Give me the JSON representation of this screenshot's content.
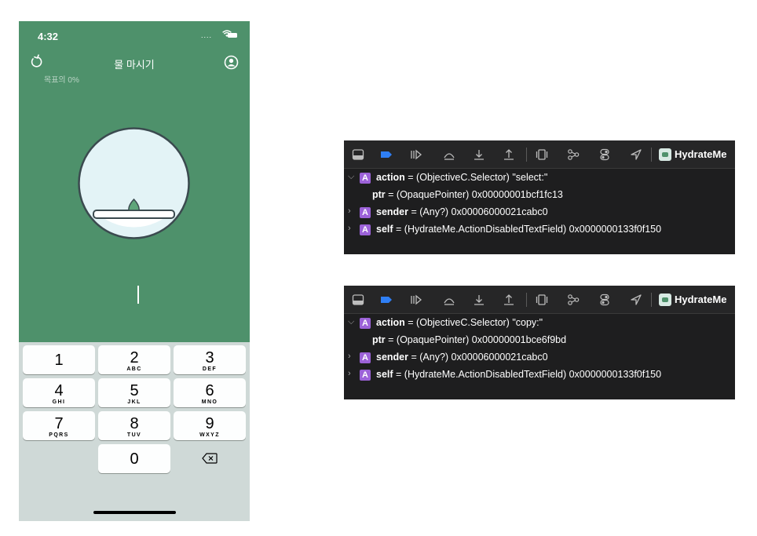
{
  "phone": {
    "status_time": "4:32",
    "signal_dots": "....",
    "nav_title": "물 마시기",
    "progress_label": "목표의 0%",
    "keys": [
      {
        "num": "1",
        "letters": ""
      },
      {
        "num": "2",
        "letters": "ABC"
      },
      {
        "num": "3",
        "letters": "DEF"
      },
      {
        "num": "4",
        "letters": "GHI"
      },
      {
        "num": "5",
        "letters": "JKL"
      },
      {
        "num": "6",
        "letters": "MNO"
      },
      {
        "num": "7",
        "letters": "PQRS"
      },
      {
        "num": "8",
        "letters": "TUV"
      },
      {
        "num": "9",
        "letters": "WXYZ"
      },
      {
        "num": "0",
        "letters": ""
      }
    ],
    "colors": {
      "background": "#4e916b",
      "keyboard": "#cfd9d7"
    }
  },
  "debug_panels": [
    {
      "app_name": "HydrateMe",
      "vars": [
        {
          "expanded": true,
          "badge": "A",
          "name": "action",
          "rest": " = (ObjectiveC.Selector) \"select:\""
        },
        {
          "child": true,
          "name": "ptr",
          "rest": " = (OpaquePointer) 0x00000001bcf1fc13"
        },
        {
          "expanded": false,
          "badge": "A",
          "name": "sender",
          "rest": " = (Any?) 0x00006000021cabc0"
        },
        {
          "expanded": false,
          "badge": "A",
          "name": "self",
          "rest": " = (HydrateMe.ActionDisabledTextField) 0x0000000133f0f150"
        }
      ]
    },
    {
      "app_name": "HydrateMe",
      "vars": [
        {
          "expanded": true,
          "badge": "A",
          "name": "action",
          "rest": " = (ObjectiveC.Selector) \"copy:\""
        },
        {
          "child": true,
          "name": "ptr",
          "rest": " = (OpaquePointer) 0x00000001bce6f9bd"
        },
        {
          "expanded": false,
          "badge": "A",
          "name": "sender",
          "rest": " = (Any?) 0x00006000021cabc0"
        },
        {
          "expanded": false,
          "badge": "A",
          "name": "self",
          "rest": " = (HydrateMe.ActionDisabledTextField) 0x0000000133f0f150"
        }
      ]
    }
  ],
  "toolbar_icons": [
    "hide-debug-area-icon",
    "breakpoints-toggle-icon",
    "continue-icon",
    "step-over-icon",
    "step-into-icon",
    "step-out-icon",
    "view-debugger-icon",
    "memory-graph-icon",
    "environment-overrides-icon",
    "simulate-location-icon"
  ],
  "colors": {
    "debug_bg": "#1e1e1f",
    "breakpoint_blue": "#2f7ff5",
    "type_badge": "#9c62d8"
  }
}
